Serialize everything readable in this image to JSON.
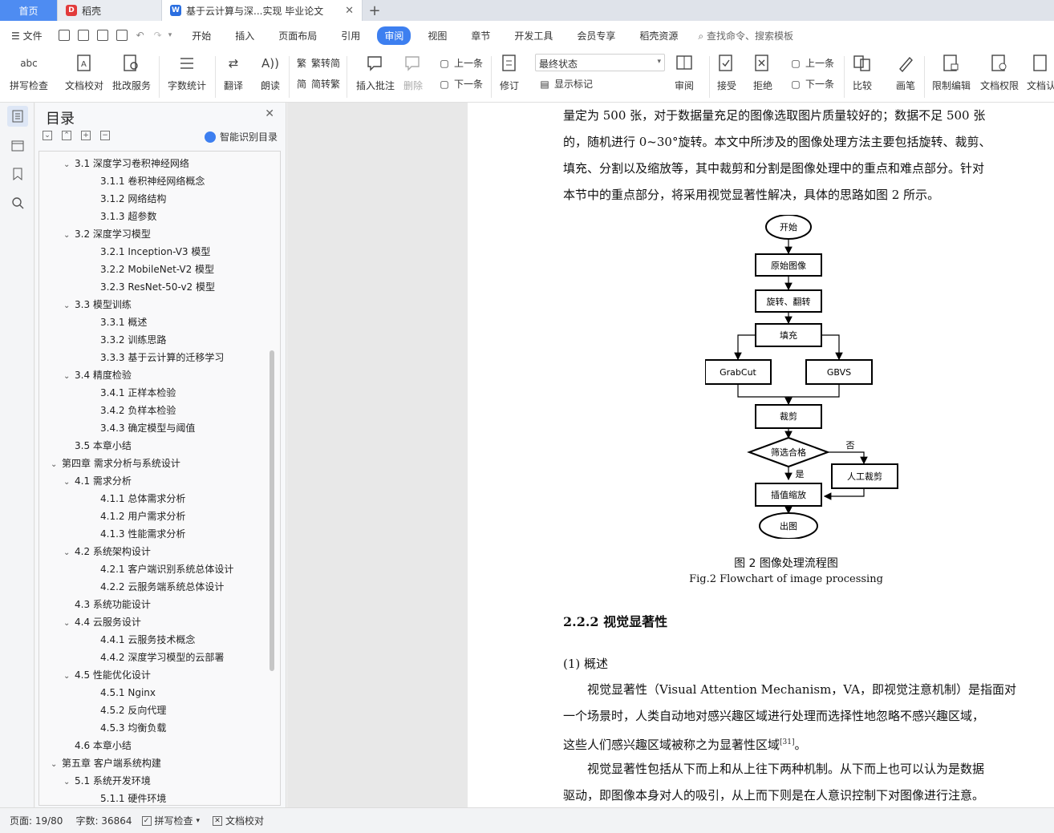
{
  "tabs": {
    "home": "首页",
    "daoke": "稻壳",
    "doc": "基于云计算与深...实现 毕业论文"
  },
  "menu": {
    "file": "文件",
    "items": [
      "开始",
      "插入",
      "页面布局",
      "引用",
      "审阅",
      "视图",
      "章节",
      "开发工具",
      "会员专享",
      "稻壳资源"
    ],
    "search": "查找命令、搜索模板"
  },
  "ribbon": {
    "spellcheck": "拼写检查",
    "doc_proof": "文档校对",
    "batch_service": "批改服务",
    "word_count": "字数统计",
    "translate": "翻译",
    "read_aloud": "朗读",
    "trad_to_simp": "繁转简",
    "simp_to_trad": "简转繁",
    "insert_comment": "插入批注",
    "delete": "删除",
    "prev_comment": "上一条",
    "next_comment": "下一条",
    "revise": "修订",
    "final_state": "最终状态",
    "show_marks": "显示标记",
    "review": "审阅",
    "accept": "接受",
    "reject": "拒绝",
    "prev_change": "上一条",
    "next_change": "下一条",
    "compare": "比较",
    "pen": "画笔",
    "restrict_edit": "限制编辑",
    "doc_permission": "文档权限",
    "doc_cert": "文档认"
  },
  "toc": {
    "title": "目录",
    "smart_label": "智能识别目录",
    "items": [
      {
        "label": "3.1  深度学习卷积神经网络",
        "level": 2,
        "caret": true
      },
      {
        "label": "3.1.1  卷积神经网络概念",
        "level": 3,
        "caret": false
      },
      {
        "label": "3.1.2  网络结构",
        "level": 3,
        "caret": false
      },
      {
        "label": "3.1.3  超参数",
        "level": 3,
        "caret": false
      },
      {
        "label": "3.2  深度学习模型",
        "level": 2,
        "caret": true
      },
      {
        "label": "3.2.1 Inception-V3 模型",
        "level": 3,
        "caret": false
      },
      {
        "label": "3.2.2 MobileNet-V2 模型",
        "level": 3,
        "caret": false
      },
      {
        "label": "3.2.3 ResNet-50-v2 模型",
        "level": 3,
        "caret": false
      },
      {
        "label": "3.3  模型训练",
        "level": 2,
        "caret": true
      },
      {
        "label": "3.3.1  概述",
        "level": 3,
        "caret": false
      },
      {
        "label": "3.3.2  训练思路",
        "level": 3,
        "caret": false
      },
      {
        "label": "3.3.3  基于云计算的迁移学习",
        "level": 3,
        "caret": false
      },
      {
        "label": "3.4  精度检验",
        "level": 2,
        "caret": true
      },
      {
        "label": "3.4.1  正样本检验",
        "level": 3,
        "caret": false
      },
      {
        "label": "3.4.2  负样本检验",
        "level": 3,
        "caret": false
      },
      {
        "label": "3.4.3  确定模型与阈值",
        "level": 3,
        "caret": false
      },
      {
        "label": "3.5  本章小结",
        "level": 2,
        "caret": false
      },
      {
        "label": "第四章  需求分析与系统设计",
        "level": 1,
        "caret": true
      },
      {
        "label": "4.1  需求分析",
        "level": 2,
        "caret": true
      },
      {
        "label": "4.1.1  总体需求分析",
        "level": 3,
        "caret": false
      },
      {
        "label": "4.1.2  用户需求分析",
        "level": 3,
        "caret": false
      },
      {
        "label": "4.1.3  性能需求分析",
        "level": 3,
        "caret": false
      },
      {
        "label": "4.2  系统架构设计",
        "level": 2,
        "caret": true
      },
      {
        "label": "4.2.1  客户端识别系统总体设计",
        "level": 3,
        "caret": false
      },
      {
        "label": "4.2.2  云服务端系统总体设计",
        "level": 3,
        "caret": false
      },
      {
        "label": "4.3  系统功能设计",
        "level": 2,
        "caret": false
      },
      {
        "label": "4.4  云服务设计",
        "level": 2,
        "caret": true
      },
      {
        "label": "4.4.1  云服务技术概念",
        "level": 3,
        "caret": false
      },
      {
        "label": "4.4.2 深度学习模型的云部署",
        "level": 3,
        "caret": false
      },
      {
        "label": "4.5  性能优化设计",
        "level": 2,
        "caret": true
      },
      {
        "label": "4.5.1 Nginx",
        "level": 3,
        "caret": false
      },
      {
        "label": "4.5.2  反向代理",
        "level": 3,
        "caret": false
      },
      {
        "label": "4.5.3  均衡负载",
        "level": 3,
        "caret": false
      },
      {
        "label": "4.6 本章小结",
        "level": 2,
        "caret": false
      },
      {
        "label": "第五章  客户端系统构建",
        "level": 1,
        "caret": true
      },
      {
        "label": "5.1 系统开发环境",
        "level": 2,
        "caret": true
      },
      {
        "label": "5.1.1  硬件环境",
        "level": 3,
        "caret": false
      }
    ]
  },
  "doc": {
    "lines_top": [
      "量定为  500 张，对于数据量充足的图像选取图片质量较好的；数据不足  500 张",
      "的，随机进行  0~30°旋转。本文中所涉及的图像处理方法主要包括旋转、裁剪、",
      "填充、分割以及缩放等，其中裁剪和分割是图像处理中的重点和难点部分。针对",
      "本节中的重点部分，将采用视觉显著性解决，具体的思路如图 2 所示。"
    ],
    "flow": {
      "start": "开始",
      "orig": "原始图像",
      "rotate": "旋转、翻转",
      "fill": "填充",
      "grabcut": "GrabCut",
      "gbvs": "GBVS",
      "crop": "裁剪",
      "check": "筛选合格",
      "no": "否",
      "manual": "人工裁剪",
      "yes": "是",
      "interp": "插值缩放",
      "out": "出图"
    },
    "caption_cn": "图 2  图像处理流程图",
    "caption_en": "Fig.2 Flowchart of image processing",
    "heading": "2.2.2  视觉显著性",
    "sub": "(1)  概述",
    "body_lines": [
      "视觉显著性（Visual Attention Mechanism，VA，即视觉注意机制）是指面对",
      "一个场景时，人类自动地对感兴趣区域进行处理而选择性地忽略不感兴趣区域，",
      "这些人们感兴趣区域被称之为显著性区域",
      "视觉显著性包括从下而上和从上往下两种机制。从下而上也可以认为是数据",
      "驱动，即图像本身对人的吸引，从上而下则是在人意识控制下对图像进行注意。"
    ],
    "cite": "[31]",
    "cite_tail": "。"
  },
  "status": {
    "page": "页面: 19/80",
    "words": "字数: 36864",
    "spell": "拼写检查",
    "proof": "文档校对"
  },
  "colors": {
    "accent": "#3d7ff0",
    "home_tab": "#4e8cf2"
  }
}
